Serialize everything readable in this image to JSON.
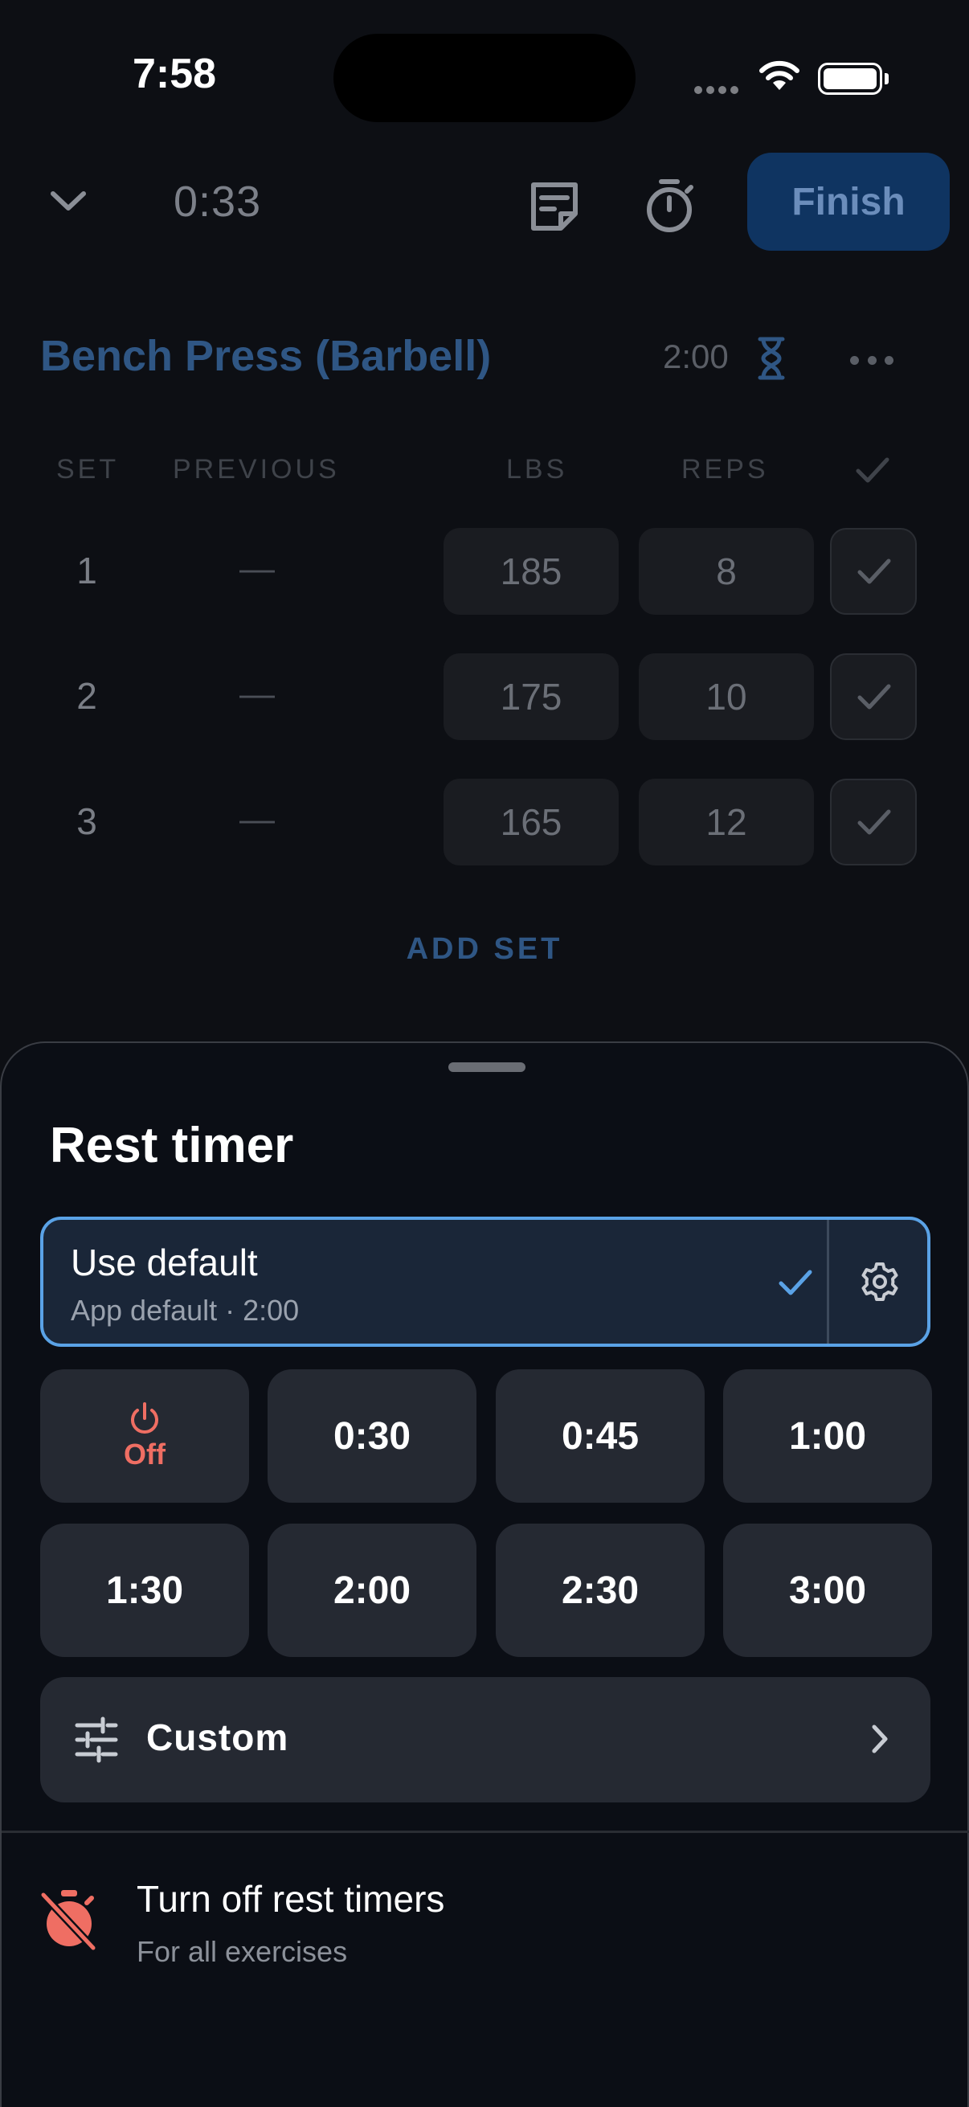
{
  "status_bar": {
    "time": "7:58"
  },
  "workout": {
    "elapsed": "0:33",
    "finish_label": "Finish",
    "exercise": {
      "title": "Bench Press (Barbell)",
      "rest": "2:00",
      "columns": {
        "set": "SET",
        "previous": "PREVIOUS",
        "lbs": "LBS",
        "reps": "REPS"
      },
      "sets": [
        {
          "num": "1",
          "previous": "—",
          "lbs": "185",
          "reps": "8"
        },
        {
          "num": "2",
          "previous": "—",
          "lbs": "175",
          "reps": "10"
        },
        {
          "num": "3",
          "previous": "—",
          "lbs": "165",
          "reps": "12"
        }
      ],
      "add_set_label": "ADD SET"
    }
  },
  "sheet": {
    "title": "Rest timer",
    "default_option": {
      "title": "Use default",
      "subtitle": "App default · 2:00",
      "selected": true
    },
    "options": [
      {
        "label": "Off",
        "icon": "power-icon"
      },
      {
        "label": "0:30"
      },
      {
        "label": "0:45"
      },
      {
        "label": "1:00"
      },
      {
        "label": "1:30"
      },
      {
        "label": "2:00"
      },
      {
        "label": "2:30"
      },
      {
        "label": "3:00"
      }
    ],
    "custom_label": "Custom",
    "turn_off": {
      "title": "Turn off rest timers",
      "subtitle": "For all exercises"
    }
  },
  "colors": {
    "accent": "#5aa2e6",
    "danger": "#ef6e63",
    "finish_bg": "#0f3461"
  }
}
